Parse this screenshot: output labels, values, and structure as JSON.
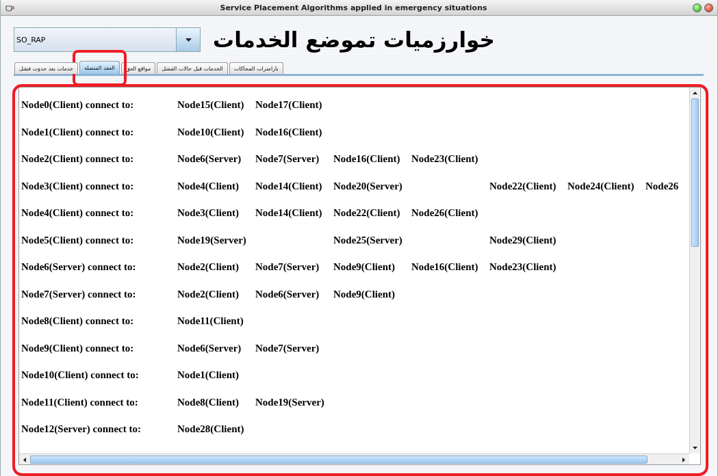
{
  "window": {
    "title": "Service Placement Algorithms applied in emergency situations"
  },
  "algorithm_select": {
    "value": "SO_RAP"
  },
  "heading": "خوارزميات تموضع الخدمات",
  "tabs": [
    {
      "label": "بارامترات المحاكات",
      "selected": false,
      "highlighted": false
    },
    {
      "label": "الخدمات قبل حالات الفشل",
      "selected": false,
      "highlighted": false
    },
    {
      "label": "مواقع العق",
      "selected": false,
      "highlighted": false
    },
    {
      "label": "العقد المتصلة",
      "selected": true,
      "highlighted": true
    },
    {
      "label": "خدمات بعد حدوث فشل",
      "selected": false,
      "highlighted": false
    }
  ],
  "panel": {
    "highlighted": true,
    "rows": [
      {
        "node": "Node0(Client) connect to:",
        "links": [
          {
            "kind": "node",
            "text": "Node15(Client)"
          },
          {
            "kind": "node",
            "text": "Node17(Client)"
          }
        ]
      },
      {
        "node": "Node1(Client) connect to:",
        "links": [
          {
            "kind": "node",
            "text": "Node10(Client)"
          },
          {
            "kind": "node",
            "text": "Node16(Client)"
          }
        ]
      },
      {
        "node": "Node2(Client) connect to:",
        "links": [
          {
            "kind": "node",
            "text": "Node6(Server)"
          },
          {
            "kind": "node",
            "text": "Node7(Server)"
          },
          {
            "kind": "node",
            "text": "Node16(Client)"
          },
          {
            "kind": "node",
            "text": "Node23(Client)"
          }
        ]
      },
      {
        "node": "Node3(Client) connect to:",
        "links": [
          {
            "kind": "node",
            "text": "Node4(Client)"
          },
          {
            "kind": "node",
            "text": "Node14(Client)"
          },
          {
            "kind": "node",
            "text": "Node20(Server)"
          },
          {
            "kind": "blank"
          },
          {
            "kind": "node",
            "text": "Node22(Client)"
          },
          {
            "kind": "node",
            "text": "Node24(Client)"
          },
          {
            "kind": "node",
            "text": "Node26"
          }
        ]
      },
      {
        "node": "Node4(Client) connect to:",
        "links": [
          {
            "kind": "node",
            "text": "Node3(Client)"
          },
          {
            "kind": "node",
            "text": "Node14(Client)"
          },
          {
            "kind": "node",
            "text": "Node22(Client)"
          },
          {
            "kind": "node",
            "text": "Node26(Client)"
          }
        ]
      },
      {
        "node": "Node5(Client) connect to:",
        "links": [
          {
            "kind": "node",
            "text": "Node19(Server)"
          },
          {
            "kind": "blank"
          },
          {
            "kind": "node",
            "text": "Node25(Server)"
          },
          {
            "kind": "blank"
          },
          {
            "kind": "node",
            "text": "Node29(Client)"
          }
        ]
      },
      {
        "node": "Node6(Server) connect to:",
        "links": [
          {
            "kind": "node",
            "text": "Node2(Client)"
          },
          {
            "kind": "node",
            "text": "Node7(Server)"
          },
          {
            "kind": "node",
            "text": "Node9(Client)"
          },
          {
            "kind": "node",
            "text": "Node16(Client)"
          },
          {
            "kind": "node",
            "text": "Node23(Client)"
          }
        ]
      },
      {
        "node": "Node7(Server) connect to:",
        "links": [
          {
            "kind": "node",
            "text": "Node2(Client)"
          },
          {
            "kind": "node",
            "text": "Node6(Server)"
          },
          {
            "kind": "node",
            "text": "Node9(Client)"
          }
        ]
      },
      {
        "node": "Node8(Client) connect to:",
        "links": [
          {
            "kind": "node",
            "text": "Node11(Client)"
          }
        ]
      },
      {
        "node": "Node9(Client) connect to:",
        "links": [
          {
            "kind": "node",
            "text": "Node6(Server)"
          },
          {
            "kind": "node",
            "text": "Node7(Server)"
          }
        ]
      },
      {
        "node": "Node10(Client) connect to:",
        "links": [
          {
            "kind": "node",
            "text": "Node1(Client)"
          }
        ]
      },
      {
        "node": "Node11(Client) connect to:",
        "links": [
          {
            "kind": "node",
            "text": "Node8(Client)"
          },
          {
            "kind": "node",
            "text": "Node19(Server)"
          }
        ]
      },
      {
        "node": "Node12(Server) connect to:",
        "links": [
          {
            "kind": "node",
            "text": "Node28(Client)"
          }
        ]
      }
    ]
  }
}
